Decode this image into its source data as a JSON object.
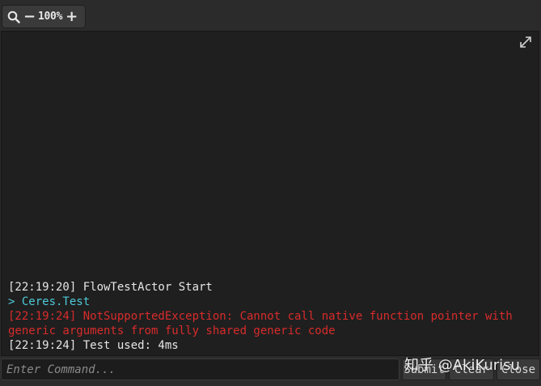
{
  "toolbar": {
    "zoom_icon": "magnifier-icon",
    "zoom_out_label": "−",
    "zoom_value": "100%",
    "zoom_in_label": "+"
  },
  "console": {
    "expand_icon": "expand-icon",
    "lines": [
      {
        "text": "[22:19:20] FlowTestActor Start",
        "color": "#e6e6e6"
      },
      {
        "text": "> Ceres.Test",
        "color": "#4ec9d8"
      },
      {
        "text": "[22:19:24] NotSupportedException: Cannot call native function pointer with generic arguments from fully shared generic code",
        "color": "#d92b2b"
      },
      {
        "text": "[22:19:24] Test used: 4ms",
        "color": "#e6e6e6"
      }
    ]
  },
  "command": {
    "placeholder": "Enter Command...",
    "submit_label": "Submit",
    "clear_label": "Clear",
    "close_label": "Close"
  },
  "watermark": {
    "text": "知乎 @AkiKurisu"
  },
  "colors": {
    "background": "#2b2b2b",
    "console_bg": "#1f1f1f",
    "log_default": "#e6e6e6",
    "log_command": "#4ec9d8",
    "log_error": "#d92b2b"
  }
}
